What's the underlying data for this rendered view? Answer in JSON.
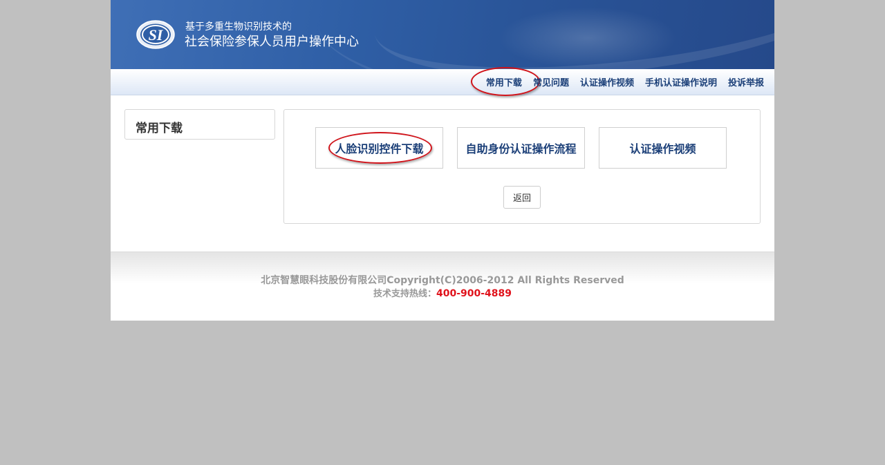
{
  "header": {
    "logo_text": "SI",
    "line1": "基于多重生物识别技术的",
    "line2": "社会保险参保人员用户操作中心"
  },
  "nav": {
    "items": [
      {
        "label": "常用下载",
        "active": true
      },
      {
        "label": "常见问题",
        "active": false
      },
      {
        "label": "认证操作视频",
        "active": false
      },
      {
        "label": "手机认证操作说明",
        "active": false
      },
      {
        "label": "投诉举报",
        "active": false
      }
    ]
  },
  "sidebar": {
    "title": "常用下载"
  },
  "main": {
    "tiles": [
      {
        "label": "人脸识别控件下载",
        "highlighted": true
      },
      {
        "label": "自助身份认证操作流程",
        "highlighted": false
      },
      {
        "label": "认证操作视频",
        "highlighted": false
      }
    ],
    "back_label": "返回"
  },
  "footer": {
    "copyright": "北京智慧眼科技股份有限公司Copyright(C)2006-2012 All Rights Reserved",
    "hotline_label": "技术支持热线：",
    "hotline_number": "400-900-4889"
  },
  "colors": {
    "page_bg": "#c0c0c0",
    "header_blue": "#2f5fa6",
    "nav_text": "#1b3f78",
    "highlight_red": "#d0131a",
    "hotline_red": "#e0121b"
  }
}
